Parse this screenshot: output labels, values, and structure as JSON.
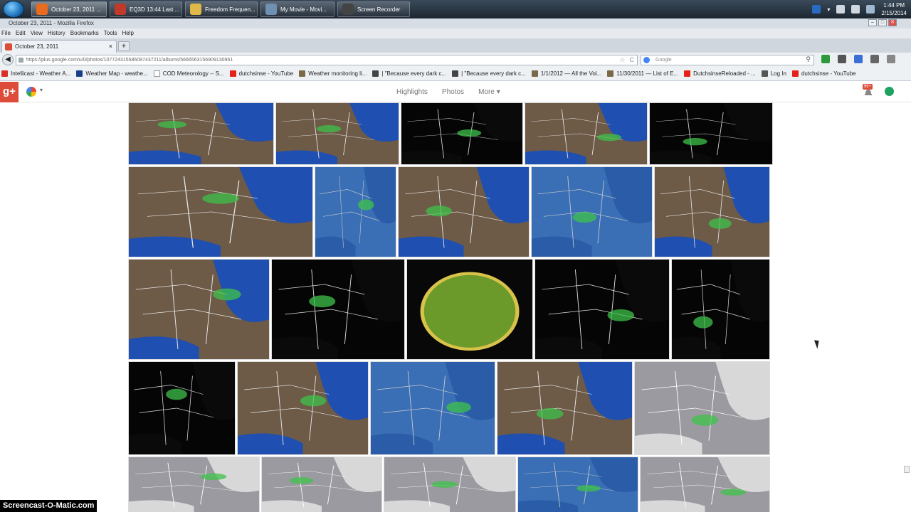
{
  "taskbar": {
    "items": [
      {
        "label": "October 23, 2011 ...",
        "color": "#e86b1f",
        "active": true
      },
      {
        "label": "EQ3D  13:44 Last ...",
        "color": "#c0392b",
        "active": false
      },
      {
        "label": "Freedom Frequen...",
        "color": "#e0b84a",
        "active": false
      },
      {
        "label": "My Movie - Movi...",
        "color": "#6f8fb3",
        "active": false
      },
      {
        "label": "Screen Recorder",
        "color": "#444444",
        "active": false
      }
    ],
    "clock_time": "1:44 PM",
    "clock_date": "2/15/2014"
  },
  "window": {
    "title": "October 23, 2011 - Mozilla Firefox",
    "minimize": "–",
    "maximize": "□",
    "close": "✕"
  },
  "menu": [
    "File",
    "Edit",
    "View",
    "History",
    "Bookmarks",
    "Tools",
    "Help"
  ],
  "tab": {
    "label": "October 23, 2011",
    "close": "×",
    "new": "+"
  },
  "nav": {
    "back": "◀",
    "url": "https://plus.google.com/u/0/photos/107724315586097437211/albums/5666563156909130961",
    "url_star": "☆",
    "url_reload": "C",
    "search_placeholder": "Google",
    "search_go": "⚲",
    "extras": [
      "#2c9a3a",
      "#555555",
      "#3b6fd6",
      "#666666",
      "#888888"
    ]
  },
  "bookmarks": [
    {
      "label": "Intellicast - Weather A...",
      "color": "#d93025"
    },
    {
      "label": "Weather Map - weathe...",
      "color": "#1a3f8a"
    },
    {
      "label": "COD Meteorology -- S...",
      "color": "#ffffff"
    },
    {
      "label": "dutchsinse - YouTube",
      "color": "#e62117"
    },
    {
      "label": "Weather monitoring li...",
      "color": "#7a6a4a"
    },
    {
      "label": "| \"Because every dark c...",
      "color": "#444444"
    },
    {
      "label": "| \"Because every dark c...",
      "color": "#444444"
    },
    {
      "label": "1/1/2012 — All the Vol...",
      "color": "#7a6a4a"
    },
    {
      "label": "11/30/2011 — List of E...",
      "color": "#7a6a4a"
    },
    {
      "label": "DutchsinseReloaded - ...",
      "color": "#e62117"
    },
    {
      "label": "Log In",
      "color": "#555555"
    },
    {
      "label": "dutchsinse - YouTube",
      "color": "#e62117"
    }
  ],
  "gplus": {
    "logo": "g+",
    "caret": "▾",
    "nav": [
      "Highlights",
      "Photos",
      "More ▾"
    ],
    "notifications": "99+"
  },
  "photos": [
    {
      "type": "map"
    },
    {
      "type": "map"
    },
    {
      "type": "dark"
    },
    {
      "type": "map"
    },
    {
      "type": "dark"
    },
    {
      "type": "map"
    },
    {
      "type": "ocean"
    },
    {
      "type": "map"
    },
    {
      "type": "ocean"
    },
    {
      "type": "map"
    },
    {
      "type": "map"
    },
    {
      "type": "dark"
    },
    {
      "type": "radar"
    },
    {
      "type": "dark"
    },
    {
      "type": "dark"
    },
    {
      "type": "dark"
    },
    {
      "type": "map"
    },
    {
      "type": "ocean"
    },
    {
      "type": "map"
    },
    {
      "type": "grey"
    },
    {
      "type": "grey"
    },
    {
      "type": "grey"
    },
    {
      "type": "grey"
    },
    {
      "type": "ocean"
    },
    {
      "type": "grey"
    }
  ],
  "watermark": "Screencast-O-Matic.com"
}
